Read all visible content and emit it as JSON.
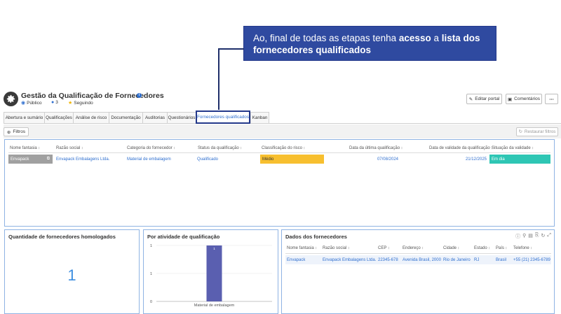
{
  "callout": {
    "text_normal_1": "Ao, final de todas as etapas tenha ",
    "text_bold_1": "acesso",
    "text_normal_2": " a ",
    "text_bold_2": "lista dos fornecedores qualificados"
  },
  "header": {
    "title": "Gestão da Qualificação de Fornecedores",
    "visibility": "Público",
    "members": "3",
    "follow": "Seguindo",
    "edit_button": "Editar portal",
    "comments_button": "Comentários",
    "more_button": "⋯"
  },
  "tabs": [
    {
      "label": "Abertura e sumário"
    },
    {
      "label": "Qualificações"
    },
    {
      "label": "Análise de risco"
    },
    {
      "label": "Documentação"
    },
    {
      "label": "Auditorias"
    },
    {
      "label": "Questionários"
    },
    {
      "label": "Fornecedores qualificados"
    },
    {
      "label": "Kanban"
    }
  ],
  "toolbar": {
    "filters_button": "Filtros",
    "restore_button": "Restaurar filtros"
  },
  "main_table": {
    "headers": [
      "Nome fantasia",
      "Razão social",
      "Categoria do fornecedor",
      "Status da qualificação",
      "Classificação do risco",
      "Data da última qualificação",
      "Data de validade da qualificação",
      "Situação da validade"
    ],
    "row": [
      "Envapack",
      "Envapack Embalagens Ltda.",
      "Material de embalagem",
      "Qualificado",
      "Médio",
      "07/08/2024",
      "21/12/2025",
      "Em dia"
    ]
  },
  "panel_count": {
    "title": "Quantidade de fornecedores homologados",
    "value": "1"
  },
  "panel_activity": {
    "title": "Por atividade de qualificação"
  },
  "chart_data": {
    "type": "bar",
    "categories": [
      "Material de embalagem"
    ],
    "values": [
      1
    ],
    "data_labels": [
      "1"
    ],
    "y_ticks": [
      "0",
      "1",
      "1"
    ],
    "ylim": [
      0,
      1
    ],
    "grid": true
  },
  "panel_suppliers": {
    "title": "Dados dos fornecedores",
    "headers": [
      "Nome fantasia",
      "Razão social",
      "CEP",
      "Endereço",
      "Cidade",
      "Estado",
      "País",
      "Telefone"
    ],
    "row": [
      "Envapack",
      "Envapack Embalagens Ltda.",
      "22345-678",
      "Avenida Brasil, 2000",
      "Rio de Janeiro",
      "RJ",
      "Brasil",
      "+55 (21) 2345-6789"
    ]
  },
  "colors": {
    "callout_bg": "#2f4aa0",
    "link": "#2f6fcf",
    "risk_medium": "#f7bf2f",
    "validity_ok": "#2ec6b4",
    "bar": "#5a5fb0",
    "big_number": "#3d8ee0"
  },
  "icons": [
    "gear-icon",
    "info-icon",
    "globe-icon",
    "users-icon",
    "star-icon",
    "pencil-icon",
    "comment-icon",
    "filter-icon",
    "refresh-icon",
    "copy-icon",
    "info-icon",
    "search-icon",
    "document-icon",
    "export-icon",
    "refresh-icon",
    "expand-icon"
  ]
}
